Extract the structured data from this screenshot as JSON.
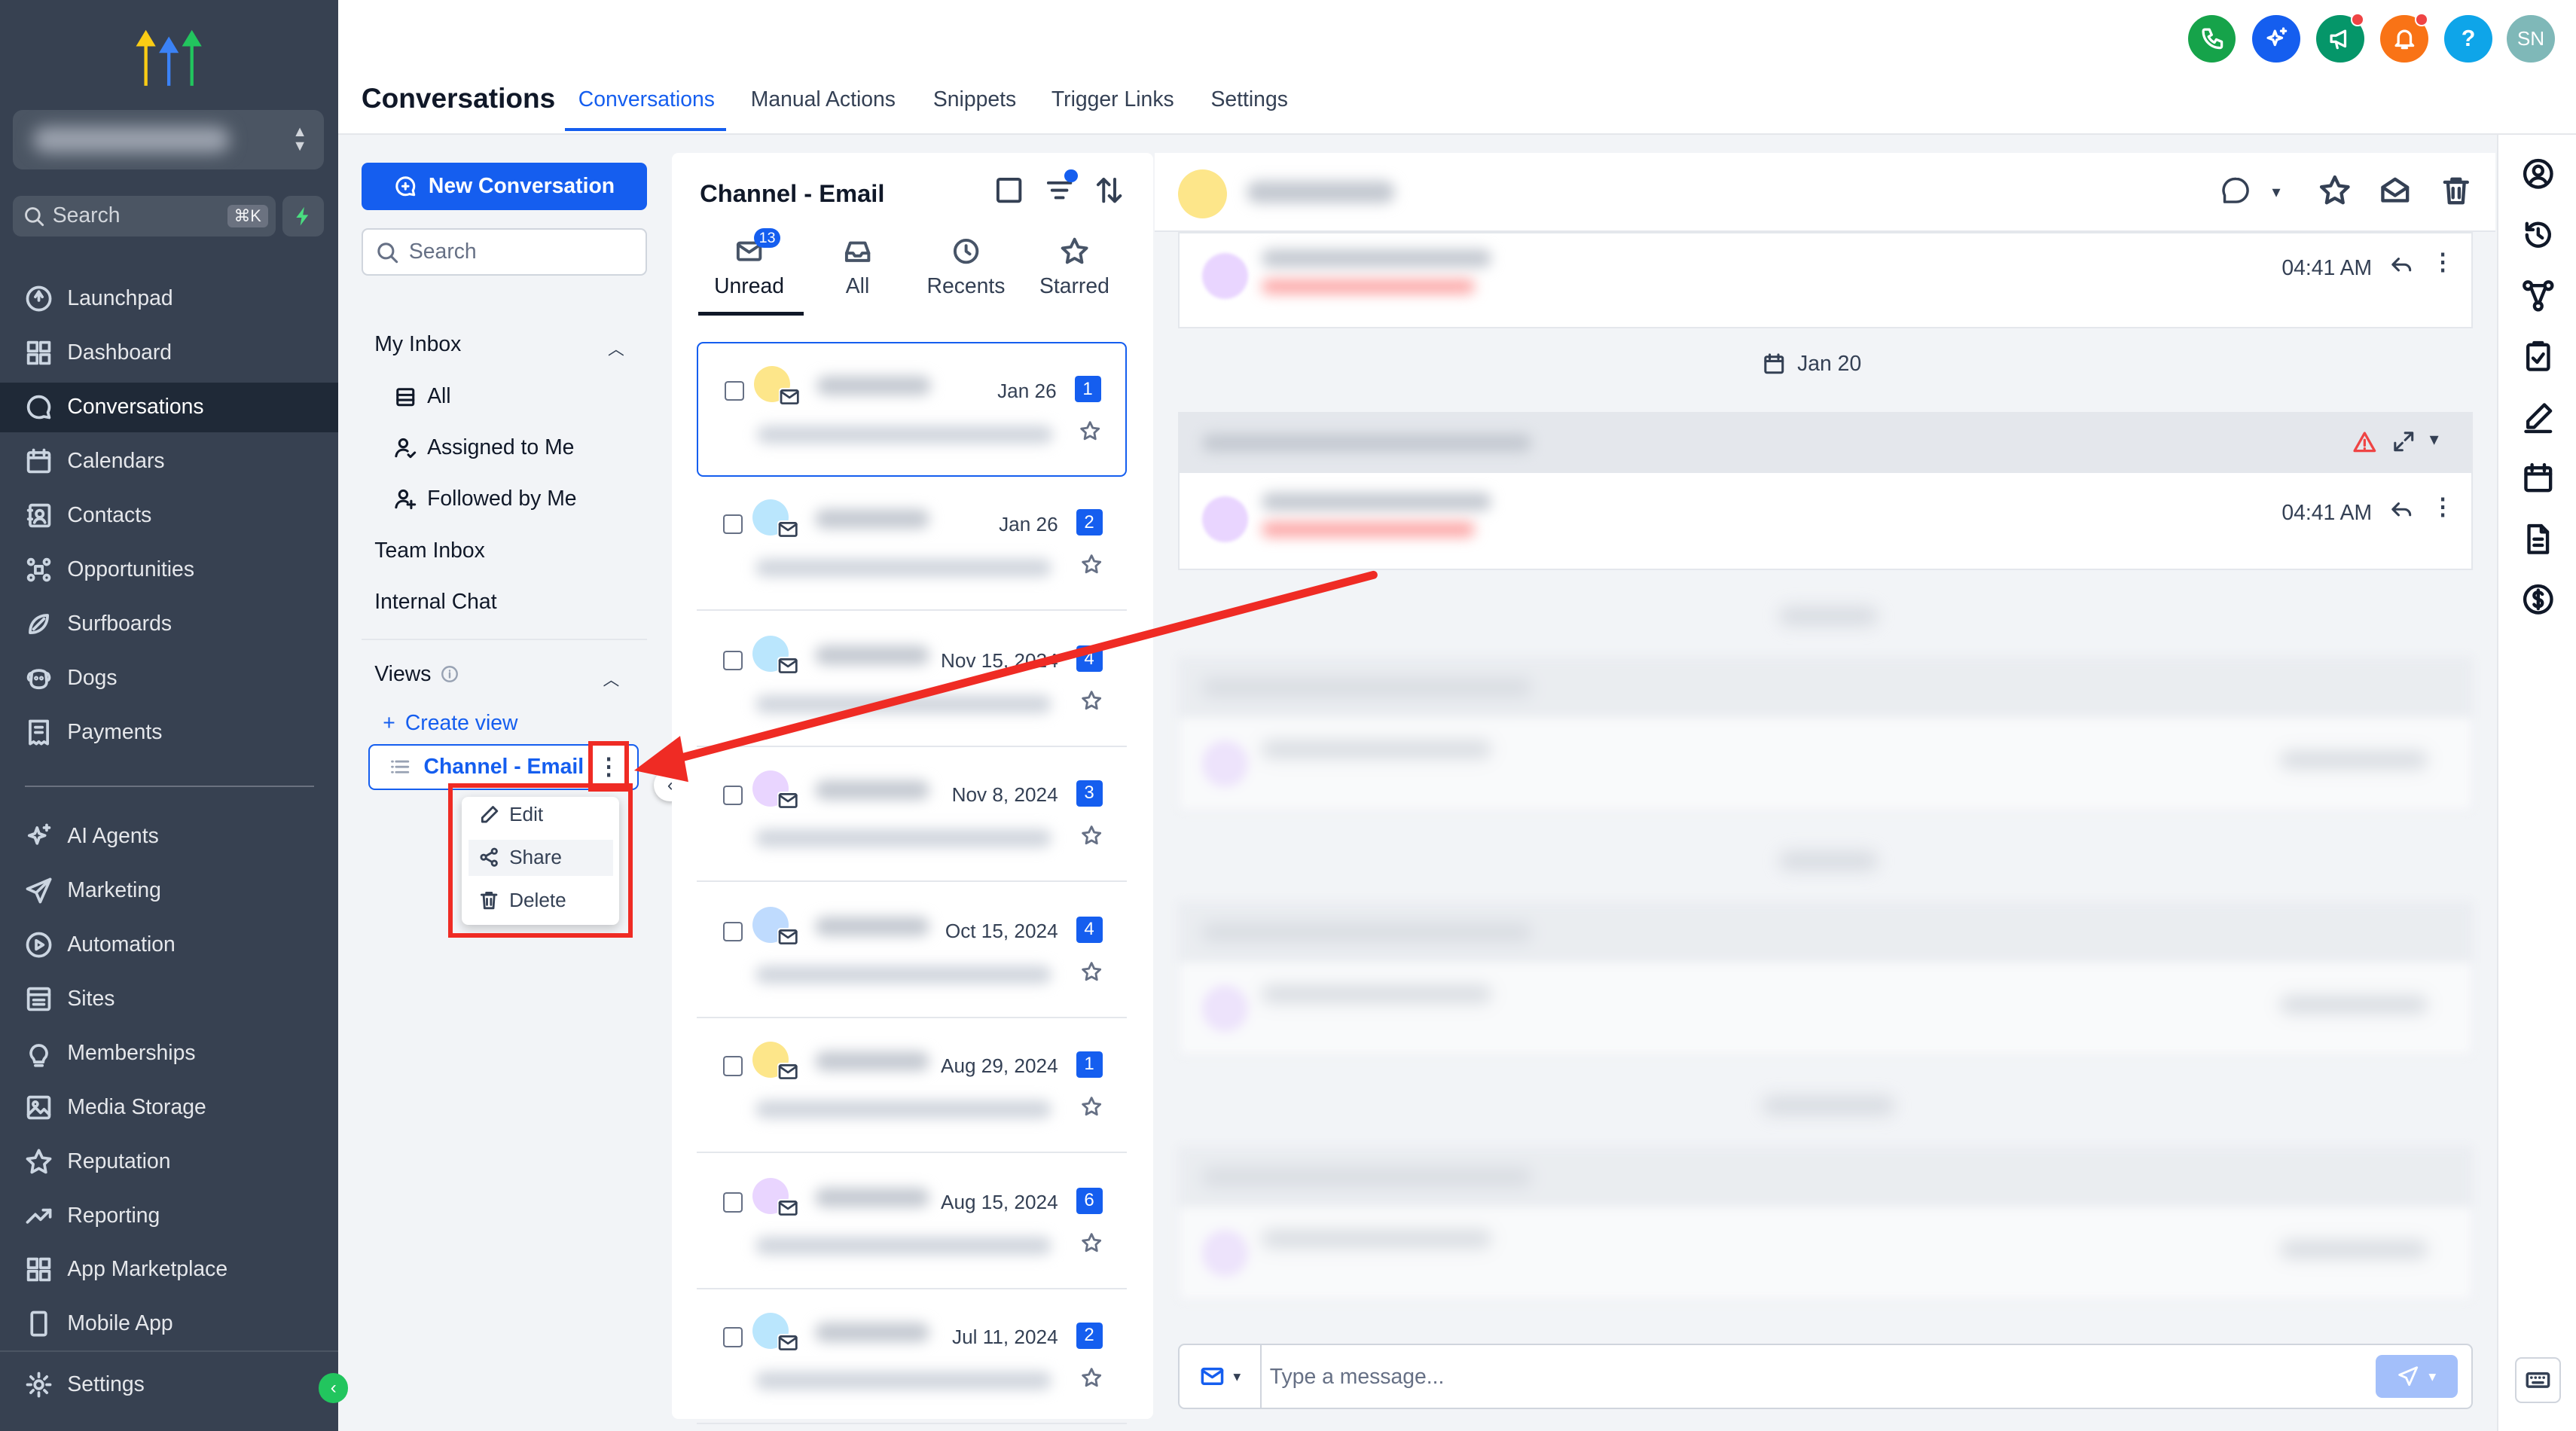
{
  "nav": {
    "search_placeholder": "Search",
    "search_shortcut": "⌘K",
    "items": [
      {
        "label": "Launchpad",
        "icon": "launchpad-icon"
      },
      {
        "label": "Dashboard",
        "icon": "dashboard-icon"
      },
      {
        "label": "Conversations",
        "icon": "chat-icon"
      },
      {
        "label": "Calendars",
        "icon": "calendar-icon"
      },
      {
        "label": "Contacts",
        "icon": "contacts-icon"
      },
      {
        "label": "Opportunities",
        "icon": "opportunities-icon"
      },
      {
        "label": "Surfboards",
        "icon": "surfboard-icon"
      },
      {
        "label": "Dogs",
        "icon": "dog-icon"
      },
      {
        "label": "Payments",
        "icon": "payments-icon"
      },
      {
        "label": "AI Agents",
        "icon": "sparkle-icon"
      },
      {
        "label": "Marketing",
        "icon": "send-icon"
      },
      {
        "label": "Automation",
        "icon": "automation-icon"
      },
      {
        "label": "Sites",
        "icon": "sites-icon"
      },
      {
        "label": "Memberships",
        "icon": "memberships-icon"
      },
      {
        "label": "Media Storage",
        "icon": "image-icon"
      },
      {
        "label": "Reputation",
        "icon": "star-icon"
      },
      {
        "label": "Reporting",
        "icon": "trend-icon"
      },
      {
        "label": "App Marketplace",
        "icon": "grid-icon"
      },
      {
        "label": "Mobile App",
        "icon": "mobile-icon"
      }
    ],
    "settings_label": "Settings"
  },
  "header": {
    "title": "Conversations",
    "tabs": [
      "Conversations",
      "Manual Actions",
      "Snippets",
      "Trigger Links",
      "Settings"
    ],
    "avatar_initials": "SN",
    "help_label": "?",
    "accent": "#155eef"
  },
  "filters": {
    "new_conversation_label": "New Conversation",
    "search_placeholder": "Search",
    "my_inbox_label": "My Inbox",
    "my_inbox_items": [
      "All",
      "Assigned to Me",
      "Followed by Me"
    ],
    "team_inbox_label": "Team Inbox",
    "internal_chat_label": "Internal Chat",
    "views_label": "Views",
    "create_view_label": "Create view",
    "view_name": "Channel - Email",
    "menu": [
      "Edit",
      "Share",
      "Delete"
    ]
  },
  "list": {
    "title": "Channel - Email",
    "tabs": [
      "Unread",
      "All",
      "Recents",
      "Starred"
    ],
    "unread_count": "13",
    "rows": [
      {
        "date": "Jan 26",
        "badge": "1",
        "avatar_color": "#fde68a"
      },
      {
        "date": "Jan 26",
        "badge": "2",
        "avatar_color": "#bae6fd"
      },
      {
        "date": "Nov 15, 2024",
        "badge": "4",
        "avatar_color": "#bae6fd"
      },
      {
        "date": "Nov 8, 2024",
        "badge": "3",
        "avatar_color": "#e9d5ff"
      },
      {
        "date": "Oct 15, 2024",
        "badge": "4",
        "avatar_color": "#bfdbfe"
      },
      {
        "date": "Aug 29, 2024",
        "badge": "1",
        "avatar_color": "#fde68a"
      },
      {
        "date": "Aug 15, 2024",
        "badge": "6",
        "avatar_color": "#e9d5ff"
      },
      {
        "date": "Jul 11, 2024",
        "badge": "2",
        "avatar_color": "#bae6fd"
      }
    ]
  },
  "conversation": {
    "messages": [
      {
        "time": "04:41 AM"
      },
      {
        "time": "04:41 AM"
      }
    ],
    "date_chip": "Jan 20",
    "composer_placeholder": "Type a message..."
  }
}
